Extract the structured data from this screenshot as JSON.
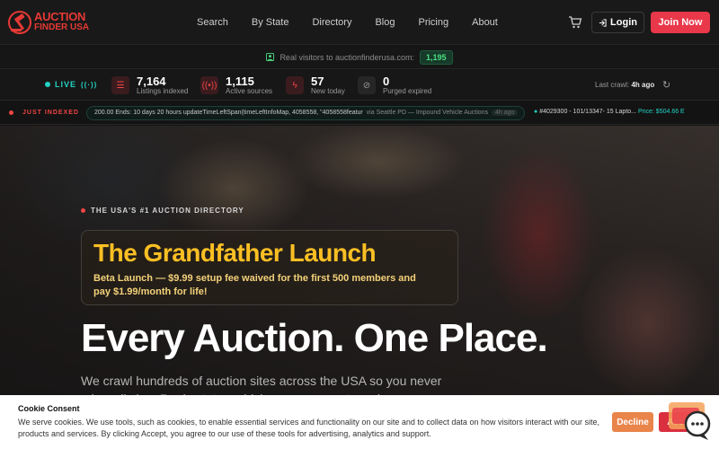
{
  "nav": {
    "logo_line1": "AUCTION",
    "logo_line2": "FINDER USA",
    "links": [
      "Search",
      "By State",
      "Directory",
      "Blog",
      "Pricing",
      "About"
    ],
    "login_label": "Login",
    "join_label": "Join Now"
  },
  "visitors": {
    "label": "Real visitors to auctionfinderusa.com:",
    "count": "1,195"
  },
  "stats": {
    "live_label": "LIVE",
    "items": [
      {
        "value": "7,164",
        "label": "Listings indexed",
        "icon": "list-icon"
      },
      {
        "value": "1,115",
        "label": "Active sources",
        "icon": "radio-icon"
      },
      {
        "value": "57",
        "label": "New today",
        "icon": "bolt-icon"
      },
      {
        "value": "0",
        "label": "Purged expired",
        "icon": "ban-icon"
      }
    ],
    "last_crawl_label": "Last crawl:",
    "last_crawl_value": "4h ago"
  },
  "ticker": {
    "label": "JUST INDEXED",
    "item1_text": "200.00 Ends: 10 days 20 hours updateTimeLeftSpan(timeLeftInfoMap, 4058558, \"4058558featur",
    "item1_source": "via Seattle PD — Impound Vehicle Auctions",
    "item1_age": "4h ago",
    "item2_text": "#4029300 - 101/13347- 15 Lapto...",
    "item2_price": "Price: $504.66 E"
  },
  "hero": {
    "eyebrow": "THE USA'S #1 AUCTION DIRECTORY",
    "promo_title": "The Grandfather Launch",
    "promo_text": "Beta Launch — $9.99 setup fee waived for the first 500 members and pay $1.99/month for life!",
    "headline": "Every Auction. One Place.",
    "subtext": "We crawl hundreds of auction sites across the USA so you never miss a listing. Real estate, vehicles, government surplus, collectibles"
  },
  "cookie": {
    "title": "Cookie Consent",
    "text": "We serve cookies. We use tools, such as cookies, to enable essential services and functionality on our site and to collect data on how visitors interact with our site, products and services. By clicking Accept, you agree to our use of these tools for advertising, analytics and support.",
    "decline_label": "Decline",
    "accept_label": "Accept"
  },
  "colors": {
    "brand_red": "#e8384a",
    "accent_teal": "#22d3c5",
    "promo_gold": "#fbbf24",
    "visitor_green": "#4ade80"
  }
}
